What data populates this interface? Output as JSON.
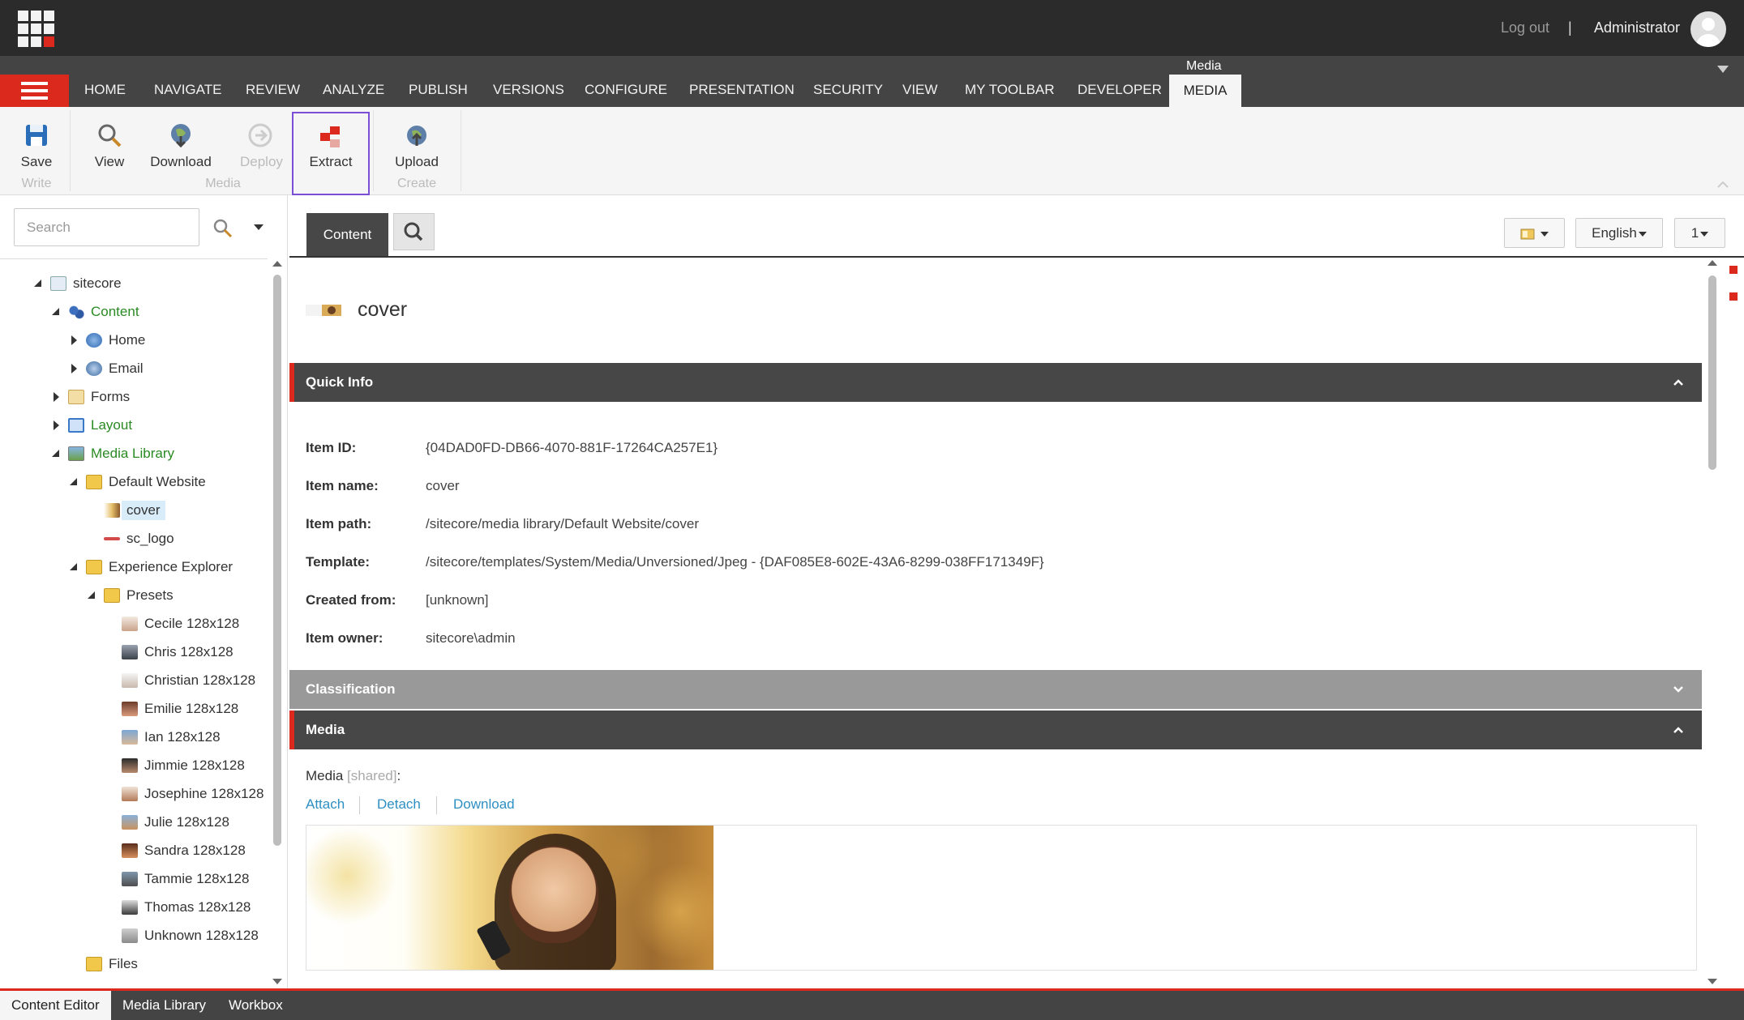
{
  "header": {
    "logout": "Log out",
    "separator": "|",
    "user": "Administrator"
  },
  "ribbon_tabs": [
    "HOME",
    "NAVIGATE",
    "REVIEW",
    "ANALYZE",
    "PUBLISH",
    "VERSIONS",
    "CONFIGURE",
    "PRESENTATION",
    "SECURITY",
    "VIEW",
    "MY TOOLBAR",
    "DEVELOPER"
  ],
  "active_tab": {
    "label": "MEDIA",
    "context": "Media"
  },
  "ribbon": {
    "save": "Save",
    "view": "View",
    "download": "Download",
    "deploy": "Deploy",
    "extract": "Extract",
    "upload": "Upload",
    "groups": {
      "write": "Write",
      "media": "Media",
      "create": "Create"
    }
  },
  "search": {
    "placeholder": "Search"
  },
  "tree": {
    "sitecore": "sitecore",
    "content": "Content",
    "home": "Home",
    "email": "Email",
    "forms": "Forms",
    "layout": "Layout",
    "media_library": "Media Library",
    "default_website": "Default Website",
    "cover": "cover",
    "sc_logo": "sc_logo",
    "experience_explorer": "Experience Explorer",
    "presets": "Presets",
    "preset_items": [
      "Cecile 128x128",
      "Chris 128x128",
      "Christian 128x128",
      "Emilie 128x128",
      "Ian 128x128",
      "Jimmie 128x128",
      "Josephine 128x128",
      "Julie 128x128",
      "Sandra 128x128",
      "Tammie 128x128",
      "Thomas 128x128",
      "Unknown 128x128"
    ],
    "files": "Files"
  },
  "editor_tabs": {
    "content": "Content"
  },
  "language": "English",
  "version": "1",
  "item": {
    "title": "cover",
    "quick_info_header": "Quick Info",
    "fields": [
      {
        "label": "Item ID:",
        "value": "{04DAD0FD-DB66-4070-881F-17264CA257E1}"
      },
      {
        "label": "Item name:",
        "value": "cover"
      },
      {
        "label": "Item path:",
        "value": "/sitecore/media library/Default Website/cover"
      },
      {
        "label": "Template:",
        "value": "/sitecore/templates/System/Media/Unversioned/Jpeg - {DAF085E8-602E-43A6-8299-038FF171349F}"
      },
      {
        "label": "Created from:",
        "value": "[unknown]"
      },
      {
        "label": "Item owner:",
        "value": "sitecore\\admin"
      }
    ],
    "classification_header": "Classification",
    "media_header": "Media",
    "media_label": "Media",
    "media_shared": "[shared]",
    "media_colon": ":",
    "attach": "Attach",
    "detach": "Detach",
    "download": "Download"
  },
  "bottom_tabs": {
    "content_editor": "Content Editor",
    "media_library": "Media Library",
    "workbox": "Workbox"
  },
  "colors": {
    "accent": "#dc291e",
    "dark": "#2b2b2b",
    "link": "#2d8fc2",
    "tree_green": "#2a8a23"
  }
}
